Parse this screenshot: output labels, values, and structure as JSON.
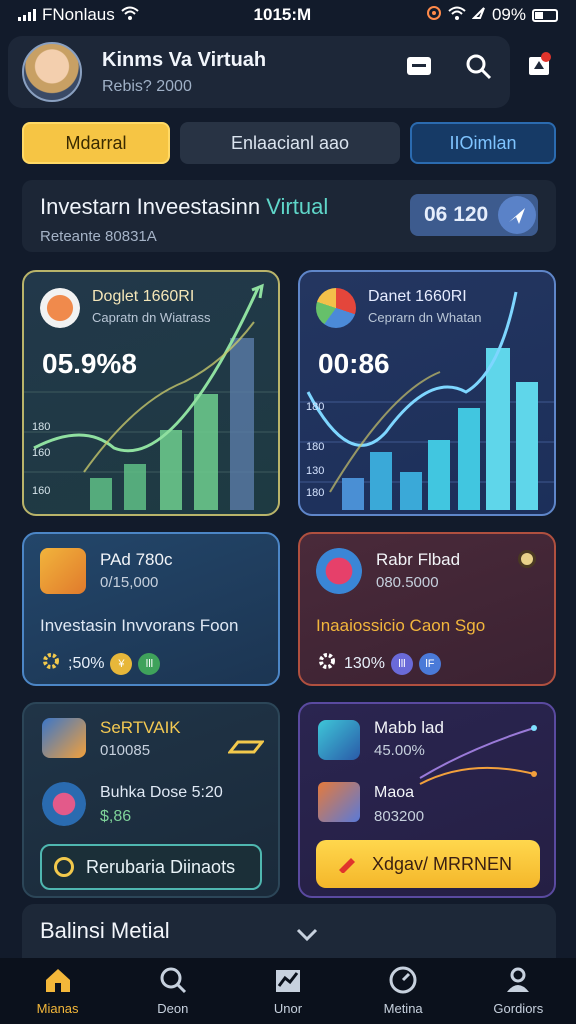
{
  "status_bar": {
    "carrier": "FNonlaus",
    "time": "1015:M",
    "battery": "09%"
  },
  "profile": {
    "name": "Kinms Va Virtuah",
    "subtitle": "Rebis? 2000"
  },
  "tabs": [
    {
      "label": "Mdarral",
      "active": true
    },
    {
      "label": "Enlaacianl aao",
      "active": false
    },
    {
      "label": "IIOimlan",
      "active": false
    }
  ],
  "banner": {
    "title_main": "Investarn Inveestasinn ",
    "title_accent": "Virtual",
    "subtitle": "Reteante 80831A",
    "pill_value": "06 120"
  },
  "charts": [
    {
      "title": "Doglet 1660RI",
      "subtitle": "Capratn dn Wiatrass",
      "value": "05.9%8",
      "axis_labels": [
        "180",
        "160",
        "160"
      ],
      "color": "#7fd39a"
    },
    {
      "title": "Danet 1660RI",
      "subtitle": "Ceprarn dn Whatan",
      "value": "00:86",
      "axis_labels": [
        "180",
        "180",
        "130",
        "180"
      ],
      "color": "#5fd6ea"
    }
  ],
  "mid_cards": [
    {
      "title": "PAd 780c",
      "subtitle": "0/15,000",
      "body": "Investasin Invvorans Foon",
      "foot": ";50%",
      "coin_a": "¥",
      "coin_b": "lll"
    },
    {
      "title": "Rabr Flbad",
      "subtitle": "080.5000",
      "body": "Inaaiossicio Caon Sgo",
      "foot": "130%",
      "coin_a": "lll",
      "coin_b": "lF"
    }
  ],
  "low_cards": [
    {
      "title": "SeRTVAIK",
      "subtitle": "010085",
      "label_b": "Buhka Dose 5:20",
      "value_b": "$,86",
      "button": "Rerubaria Diinaots"
    },
    {
      "title": "Mabb lad",
      "subtitle": "45.00%",
      "label_b": "Maoa",
      "value_b": "803200",
      "button": "Xdgav/ MRRNEN"
    }
  ],
  "section": {
    "label": "Balinsi Metial"
  },
  "bottom_nav": [
    {
      "label": "Mianas",
      "icon": "home-icon",
      "active": true
    },
    {
      "label": "Deon",
      "icon": "search-icon",
      "active": false
    },
    {
      "label": "Unor",
      "icon": "chart-icon",
      "active": false
    },
    {
      "label": "Metina",
      "icon": "gauge-icon",
      "active": false
    },
    {
      "label": "Gordiors",
      "icon": "user-icon",
      "active": false
    }
  ]
}
